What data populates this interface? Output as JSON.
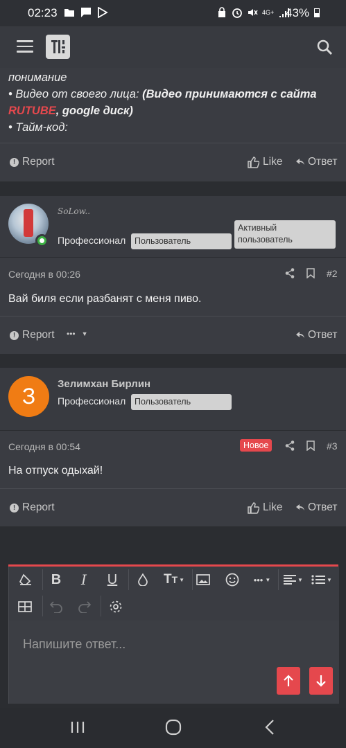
{
  "status_bar": {
    "time": "02:23",
    "network": "4G+",
    "battery": "43%"
  },
  "post1": {
    "line1": "понимание",
    "line2_prefix": "• Видео от своего лица:",
    "line2_bold": "(Видео принимаются с сайта",
    "line3_red": "RUTUBE",
    "line3_rest": ", google диск)",
    "line4": "• Тайм-код:",
    "report_label": "Report",
    "like_label": "Like",
    "reply_label": "Ответ"
  },
  "post2": {
    "username": "SoLow..",
    "rank": "Профессионал",
    "badge1": "Пользователь",
    "badge2": "Активный пользователь",
    "timestamp": "Сегодня в 00:26",
    "number": "#2",
    "message": "Вай биля если разбанят с меня пиво.",
    "report_label": "Report",
    "more_label": "•••",
    "reply_label": "Ответ"
  },
  "post3": {
    "avatar_letter": "З",
    "username": "Зелимхан Бирлин",
    "rank": "Профессионал",
    "badge1": "Пользователь",
    "timestamp": "Сегодня в 00:54",
    "new_badge": "Новое",
    "number": "#3",
    "message": "На отпуск одыхай!",
    "report_label": "Report",
    "like_label": "Like",
    "reply_label": "Ответ"
  },
  "editor": {
    "placeholder": "Напишите ответ...",
    "toolbar_bold": "B",
    "toolbar_italic": "I",
    "toolbar_underline": "U",
    "toolbar_more": "•••"
  },
  "colors": {
    "accent": "#e5484d",
    "avatar_orange": "#f07c14",
    "online_green": "#3cb043"
  }
}
